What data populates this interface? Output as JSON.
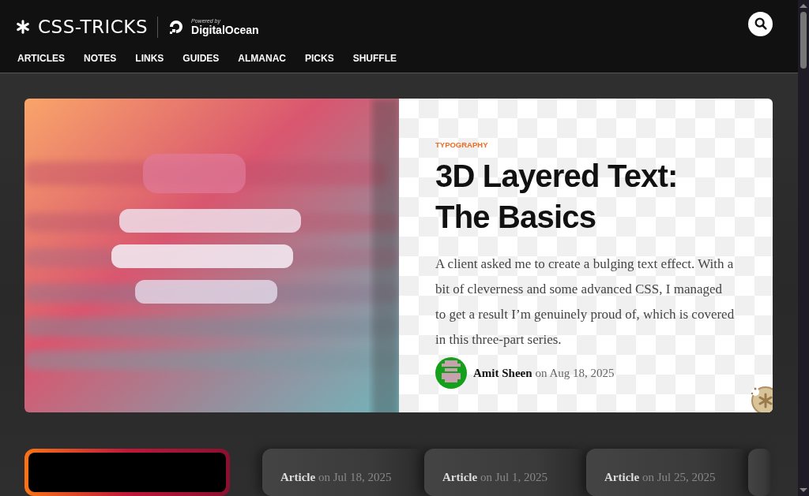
{
  "header": {
    "logo": "CSS-TRICKS",
    "sponsor_caption": "Powered by",
    "sponsor_name": "DigitalOcean",
    "nav": [
      "ARTICLES",
      "NOTES",
      "LINKS",
      "GUIDES",
      "ALMANAC",
      "PICKS",
      "SHUFFLE"
    ]
  },
  "hero": {
    "category": "TYPOGRAPHY",
    "title": "3D Layered Text: The Basics",
    "excerpt": "A client asked me to create a bulging text effect. With a bit of cleverness and some advanced CSS, I managed to get a result I’m genuinely proud of, which is covered in this three-part series.",
    "author": "Amit Sheen",
    "date_prefix": "on",
    "date": "Aug 18, 2025"
  },
  "cards": [
    {
      "kind": "featured"
    },
    {
      "kind": "article",
      "type": "Article",
      "date_prefix": "on",
      "date": "Jul 18, 2025"
    },
    {
      "kind": "article",
      "type": "Article",
      "date_prefix": "on",
      "date": "Jul 1, 2025"
    },
    {
      "kind": "article",
      "type": "Article",
      "date_prefix": "on",
      "date": "Jul 25, 2025"
    },
    {
      "kind": "stub"
    }
  ]
}
